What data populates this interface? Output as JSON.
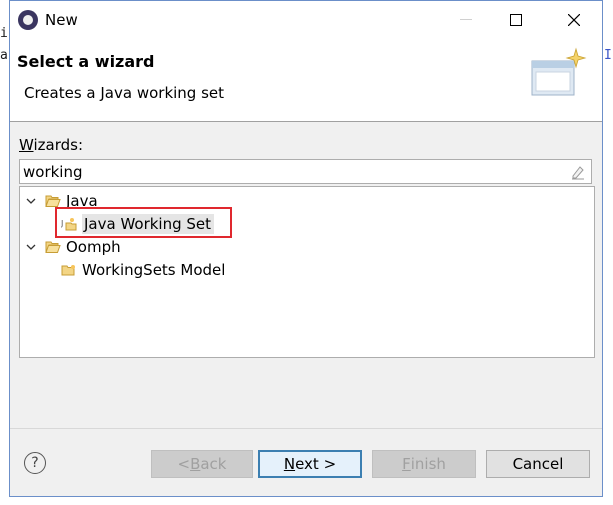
{
  "window": {
    "title": "New"
  },
  "header": {
    "title": "Select a wizard",
    "subtitle": "Creates a Java working set"
  },
  "wizards": {
    "label_mnemonic": "W",
    "label_rest": "izards:",
    "filter_value": "working"
  },
  "tree": [
    {
      "label": "Java",
      "type": "folder",
      "expanded": true
    },
    {
      "label": "Java Working Set",
      "type": "wizard",
      "selected": true
    },
    {
      "label": "Oomph",
      "type": "folder",
      "expanded": true
    },
    {
      "label": "WorkingSets Model",
      "type": "wizard",
      "selected": false
    }
  ],
  "buttons": {
    "help": "?",
    "back": {
      "prefix": "< ",
      "mnemonic": "B",
      "rest": "ack",
      "enabled": false
    },
    "next": {
      "mnemonic": "N",
      "rest": "ext >",
      "enabled": true
    },
    "finish": {
      "mnemonic": "F",
      "rest": "inish",
      "enabled": false
    },
    "cancel": {
      "label": "Cancel",
      "enabled": true
    }
  },
  "colors": {
    "highlight_box": "#e0282e",
    "window_border": "#6b8fc9",
    "default_button_border": "#3c7fb1"
  }
}
